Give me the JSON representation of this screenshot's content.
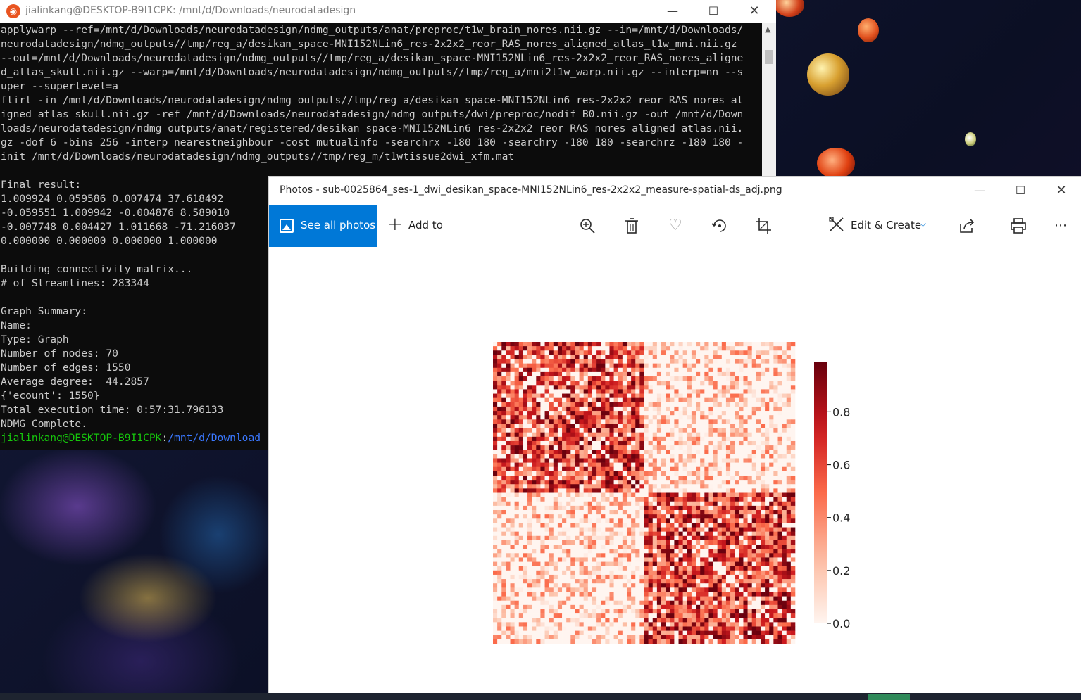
{
  "terminal": {
    "title": "jialinkang@DESKTOP-B9I1CPK: /mnt/d/Downloads/neurodatadesign",
    "lines": [
      "applywarp --ref=/mnt/d/Downloads/neurodatadesign/ndmg_outputs/anat/preproc/t1w_brain_nores.nii.gz --in=/mnt/d/Downloads/",
      "neurodatadesign/ndmg_outputs//tmp/reg_a/desikan_space-MNI152NLin6_res-2x2x2_reor_RAS_nores_aligned_atlas_t1w_mni.nii.gz",
      "--out=/mnt/d/Downloads/neurodatadesign/ndmg_outputs//tmp/reg_a/desikan_space-MNI152NLin6_res-2x2x2_reor_RAS_nores_aligne",
      "d_atlas_skull.nii.gz --warp=/mnt/d/Downloads/neurodatadesign/ndmg_outputs//tmp/reg_a/mni2t1w_warp.nii.gz --interp=nn --s",
      "uper --superlevel=a",
      "flirt -in /mnt/d/Downloads/neurodatadesign/ndmg_outputs//tmp/reg_a/desikan_space-MNI152NLin6_res-2x2x2_reor_RAS_nores_al",
      "igned_atlas_skull.nii.gz -ref /mnt/d/Downloads/neurodatadesign/ndmg_outputs/dwi/preproc/nodif_B0.nii.gz -out /mnt/d/Down",
      "loads/neurodatadesign/ndmg_outputs/anat/registered/desikan_space-MNI152NLin6_res-2x2x2_reor_RAS_nores_aligned_atlas.nii.",
      "gz -dof 6 -bins 256 -interp nearestneighbour -cost mutualinfo -searchrx -180 180 -searchry -180 180 -searchrz -180 180 -",
      "init /mnt/d/Downloads/neurodatadesign/ndmg_outputs//tmp/reg_m/t1wtissue2dwi_xfm.mat",
      "",
      "Final result:",
      "1.009924 0.059586 0.007474 37.618492",
      "-0.059551 1.009942 -0.004876 8.589010",
      "-0.007748 0.004427 1.011668 -71.216037",
      "0.000000 0.000000 0.000000 1.000000",
      "",
      "Building connectivity matrix...",
      "# of Streamlines: 283344",
      "",
      "Graph Summary:",
      "Name:",
      "Type: Graph",
      "Number of nodes: 70",
      "Number of edges: 1550",
      "Average degree:  44.2857",
      "{'ecount': 1550}",
      "Total execution time: 0:57:31.796133",
      "NDMG Complete."
    ],
    "prompt_user": "jialinkang@DESKTOP-B9I1CPK",
    "prompt_sep": ":",
    "prompt_path": "/mnt/d/Download",
    "colors": {
      "background": "#0c0c0c",
      "text": "#cccccc",
      "prompt_user": "#16c60c",
      "prompt_path": "#3b78ff"
    }
  },
  "photos": {
    "title": "Photos - sub-0025864_ses-1_dwi_desikan_space-MNI152NLin6_res-2x2x2_measure-spatial-ds_adj.png",
    "toolbar": {
      "see_all": "See all photos",
      "add_to": "Add to",
      "edit_create": "Edit & Create",
      "icons": [
        "zoom-icon",
        "delete-icon",
        "favorite-icon",
        "rotate-icon",
        "crop-icon",
        "share-icon",
        "print-icon",
        "more-icon"
      ]
    },
    "accent": "#0078d7"
  },
  "chart_data": {
    "type": "heatmap",
    "rows": 70,
    "cols": 70,
    "blocks": [
      {
        "range": [
          0,
          35
        ],
        "level": "dense"
      },
      {
        "range": [
          35,
          70
        ],
        "level": "dense"
      }
    ],
    "colorbar": {
      "min": 0.0,
      "max": 0.99,
      "ticks": [
        0.8,
        0.6,
        0.4,
        0.2,
        0.0
      ],
      "tick_labels": [
        "0.8",
        "0.6",
        "0.4",
        "0.2",
        "0.0"
      ],
      "colormap": "Reds"
    }
  }
}
